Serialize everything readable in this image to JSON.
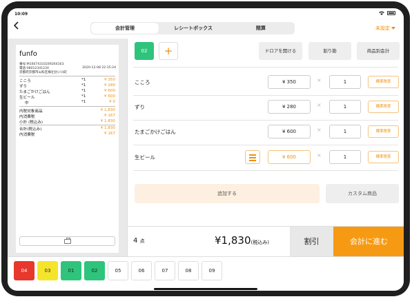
{
  "status": {
    "time": "10:09"
  },
  "nav": {
    "back_icon": "chevron-left-icon",
    "tabs": [
      {
        "label": "会計管理",
        "active": true
      },
      {
        "label": "レシートボックス",
        "active": false
      },
      {
        "label": "精算",
        "active": false
      }
    ],
    "unset_label": "未設定"
  },
  "receipt": {
    "store": "funfo",
    "number": "番号:M16074333249264163",
    "phone": "電話:08012341234",
    "date": "2020-12-08 22:15:24",
    "address": "京都府京都市山科区椥辻封ジ川町",
    "items": [
      {
        "name": "こころ",
        "qty": "*1",
        "price": "¥ 350"
      },
      {
        "name": "ずり",
        "qty": "*1",
        "price": "¥ 280"
      },
      {
        "name": "たまごかけごはん",
        "qty": "*1",
        "price": "¥ 600"
      },
      {
        "name": "生ビール",
        "qty": "*1",
        "price": "¥ 600"
      },
      {
        "name": "中",
        "qty": "*1",
        "price": "¥ 0"
      }
    ],
    "summary": [
      {
        "name": "内税対象商品",
        "price": "¥ 1,830"
      },
      {
        "name": "内消費税",
        "price": "¥ 167"
      },
      {
        "name": "小計 (税込み)",
        "price": "¥ 1,830"
      },
      {
        "name": "合計(税込み)",
        "price": "¥ 1,830"
      },
      {
        "name": "内消費税",
        "price": "¥ 167"
      }
    ],
    "print_icon": "printer-icon"
  },
  "toolbar": {
    "active_tab": "02",
    "add_tab_icon": "plus-icon",
    "open_drawer": "ドロアを開ける",
    "split": "割り勘",
    "per_item": "商品別会計"
  },
  "order_items": [
    {
      "name": "こころ",
      "price": "¥ 350",
      "qty": "1",
      "tax": "標準税率",
      "has_menu": false
    },
    {
      "name": "ずり",
      "price": "¥ 280",
      "qty": "1",
      "tax": "標準税率",
      "has_menu": false
    },
    {
      "name": "たまごかけごはん",
      "price": "¥ 600",
      "qty": "1",
      "tax": "標準税率",
      "has_menu": false
    },
    {
      "name": "生ビール",
      "price": "¥ 600",
      "qty": "1",
      "tax": "標準税率",
      "has_menu": true
    }
  ],
  "actions": {
    "add": "追加する",
    "custom": "カスタム商品"
  },
  "footer": {
    "count": "4",
    "count_unit": "点",
    "total": "¥1,830",
    "total_suffix": "(税込み)",
    "discount": "割引",
    "checkout": "会計に進む"
  },
  "tables": [
    {
      "label": "04",
      "color": "#e8372c",
      "text": "#ffffff"
    },
    {
      "label": "03",
      "color": "#f5e52a",
      "text": "#222222"
    },
    {
      "label": "01",
      "color": "#2fc47b",
      "text": "#222222"
    },
    {
      "label": "02",
      "color": "#2fc47b",
      "text": "#222222"
    },
    {
      "label": "05",
      "color": "#ffffff",
      "text": "#222222"
    },
    {
      "label": "06",
      "color": "#ffffff",
      "text": "#222222"
    },
    {
      "label": "07",
      "color": "#ffffff",
      "text": "#222222"
    },
    {
      "label": "08",
      "color": "#ffffff",
      "text": "#222222"
    },
    {
      "label": "09",
      "color": "#ffffff",
      "text": "#222222"
    }
  ]
}
